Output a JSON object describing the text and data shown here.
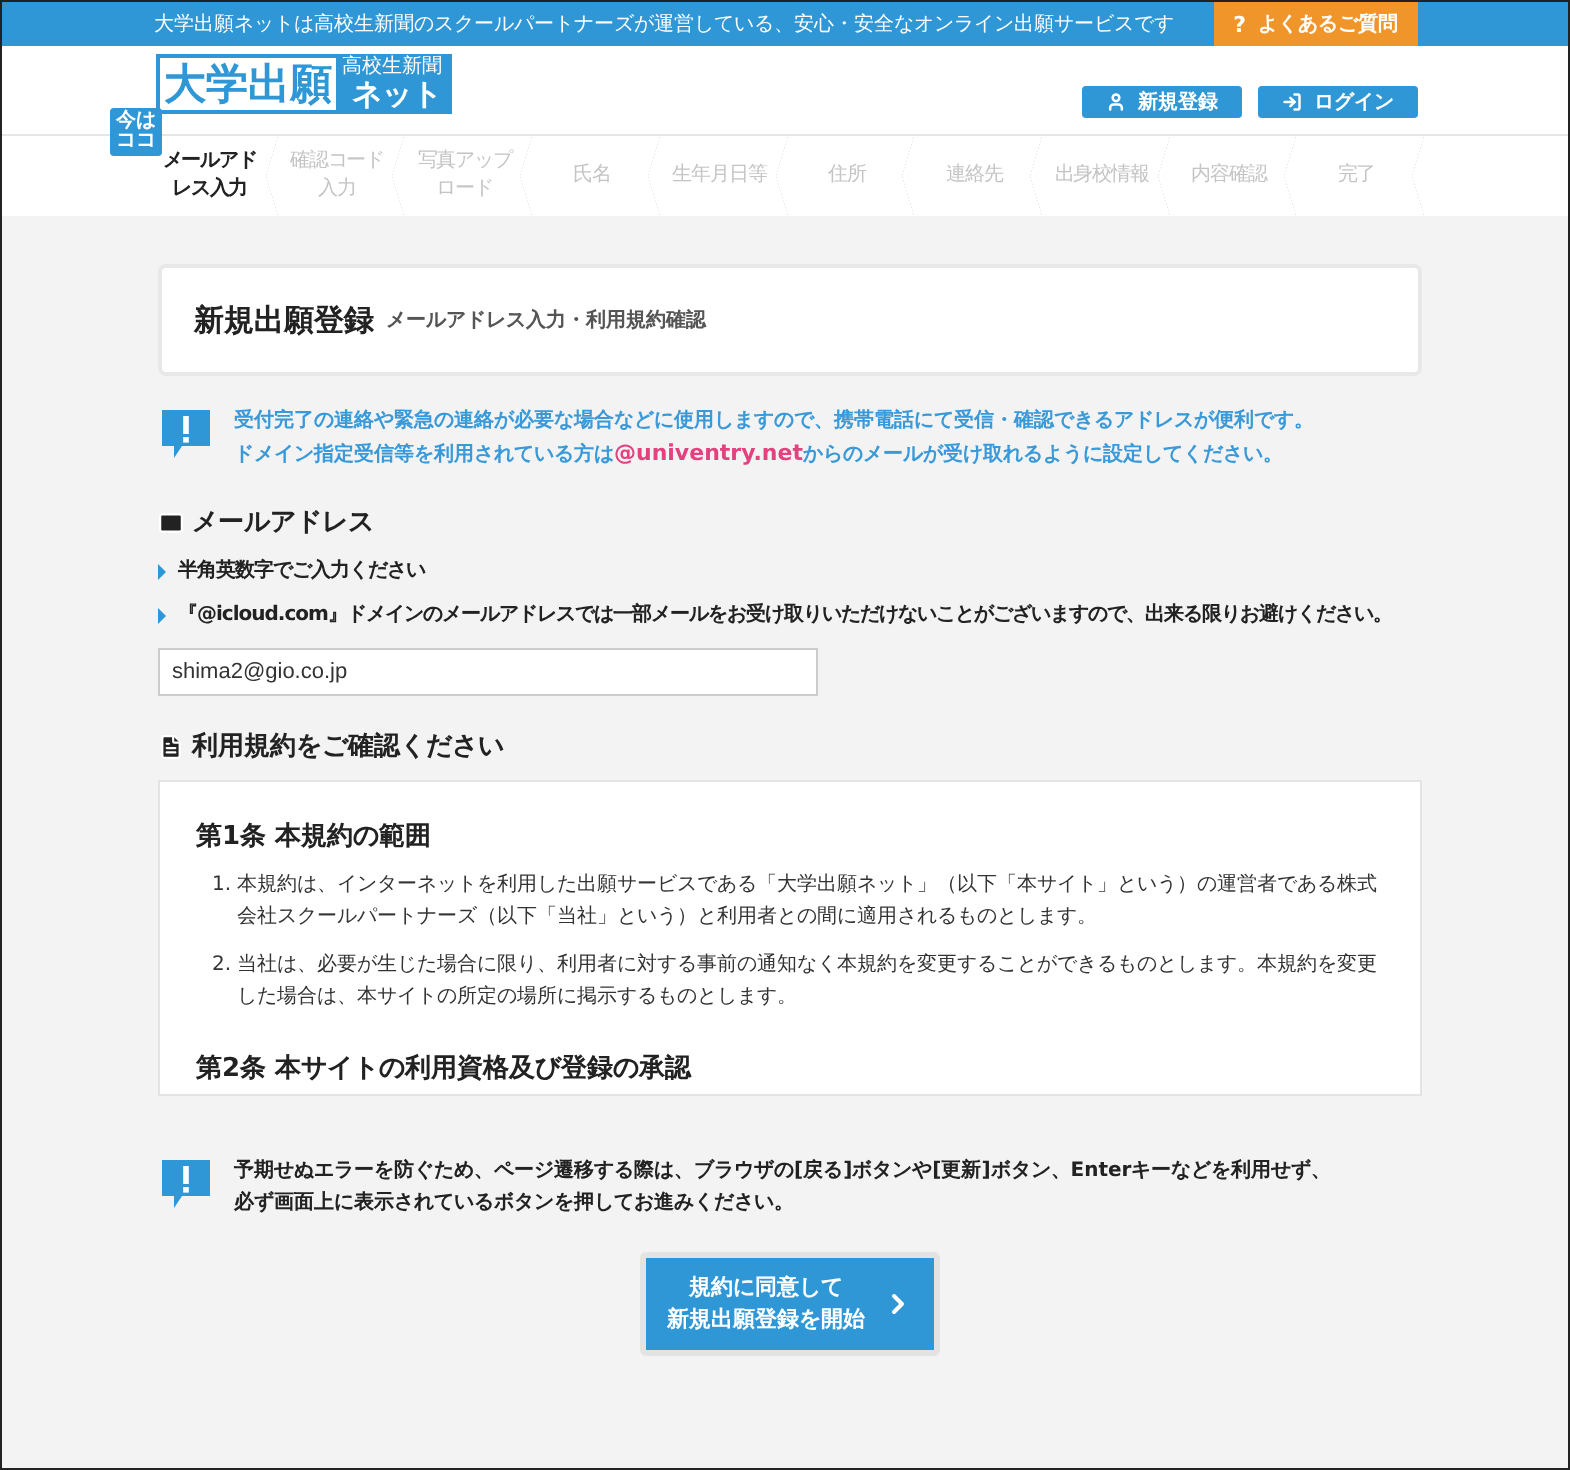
{
  "top_bar": {
    "tagline": "大学出願ネットは高校生新聞のスクールパートナーズが運営している、安心・安全なオンライン出願サービスです",
    "help_icon": "?",
    "help_link": "よくあるご質問"
  },
  "logo": {
    "main": "大学出願",
    "sub": "高校生新聞",
    "net": "ネット"
  },
  "header_buttons": [
    {
      "label": "新規登録"
    },
    {
      "label": "ログイン"
    }
  ],
  "current_badge": [
    "今は",
    "ココ"
  ],
  "steps": [
    {
      "label": "メールアドレス入力",
      "selected": true
    },
    {
      "label": "確認コード入力",
      "selected": false
    },
    {
      "label": "写真アップロード",
      "selected": false
    },
    {
      "label": "氏名",
      "selected": false
    },
    {
      "label": "生年月日等",
      "selected": false
    },
    {
      "label": "住所",
      "selected": false
    },
    {
      "label": "連絡先",
      "selected": false
    },
    {
      "label": "出身校情報",
      "selected": false
    },
    {
      "label": "内容確認",
      "selected": false
    },
    {
      "label": "完了",
      "selected": false
    }
  ],
  "page_title": {
    "title": "新規出願登録",
    "subtitle": "メールアドレス入力・利用規約確認"
  },
  "notice": {
    "lines": [
      [
        {
          "text": "受付完了の連絡や緊急の連絡が必要な場合などに使用しますので、携帯電話にて受信・確認できるアドレスが便利です。",
          "highlight": false
        }
      ],
      [
        {
          "text": "ドメイン指定受信等を利用されている方は",
          "highlight": false
        },
        {
          "text": "@univentry.net",
          "highlight": true
        },
        {
          "text": "からのメールが受け取れるように設定してください。",
          "highlight": false
        }
      ]
    ]
  },
  "email_section": {
    "heading": "メールアドレス",
    "notes": [
      "半角英数字でご入力ください",
      "『@icloud.com』ドメインのメールアドレスでは一部メールをお受け取りいただけないことがございますので、出来る限りお避けください。"
    ],
    "value": "shima2@gio.co.jp"
  },
  "terms": {
    "heading": "利用規約をご確認ください",
    "articles": [
      {
        "title": "第1条 本規約の範囲",
        "items": [
          {
            "number": "1.",
            "text": "本規約は、インターネットを利用した出願サービスである「大学出願ネット」（以下「本サイト」という）の運営者である株式会社スクールパートナーズ（以下「当社」という）と利用者との間に適用されるものとします。"
          },
          {
            "number": "2.",
            "text": "当社は、必要が生じた場合に限り、利用者に対する事前の通知なく本規約を変更することができるものとします。本規約を変更した場合は、本サイトの所定の場所に掲示するものとします。"
          }
        ]
      },
      {
        "title": "第2条 本サイトの利用資格及び登録の承認"
      }
    ]
  },
  "warning": {
    "lines": [
      "予期せぬエラーを防ぐため、ページ遷移する際は、ブラウザの[戻る]ボタンや[更新]ボタン、Enterキーなどを利用せず、",
      "必ず画面上に表示されているボタンを押してお進みください。"
    ]
  },
  "submit_button": {
    "lines": [
      "規約に同意して",
      "新規出願登録を開始"
    ]
  }
}
